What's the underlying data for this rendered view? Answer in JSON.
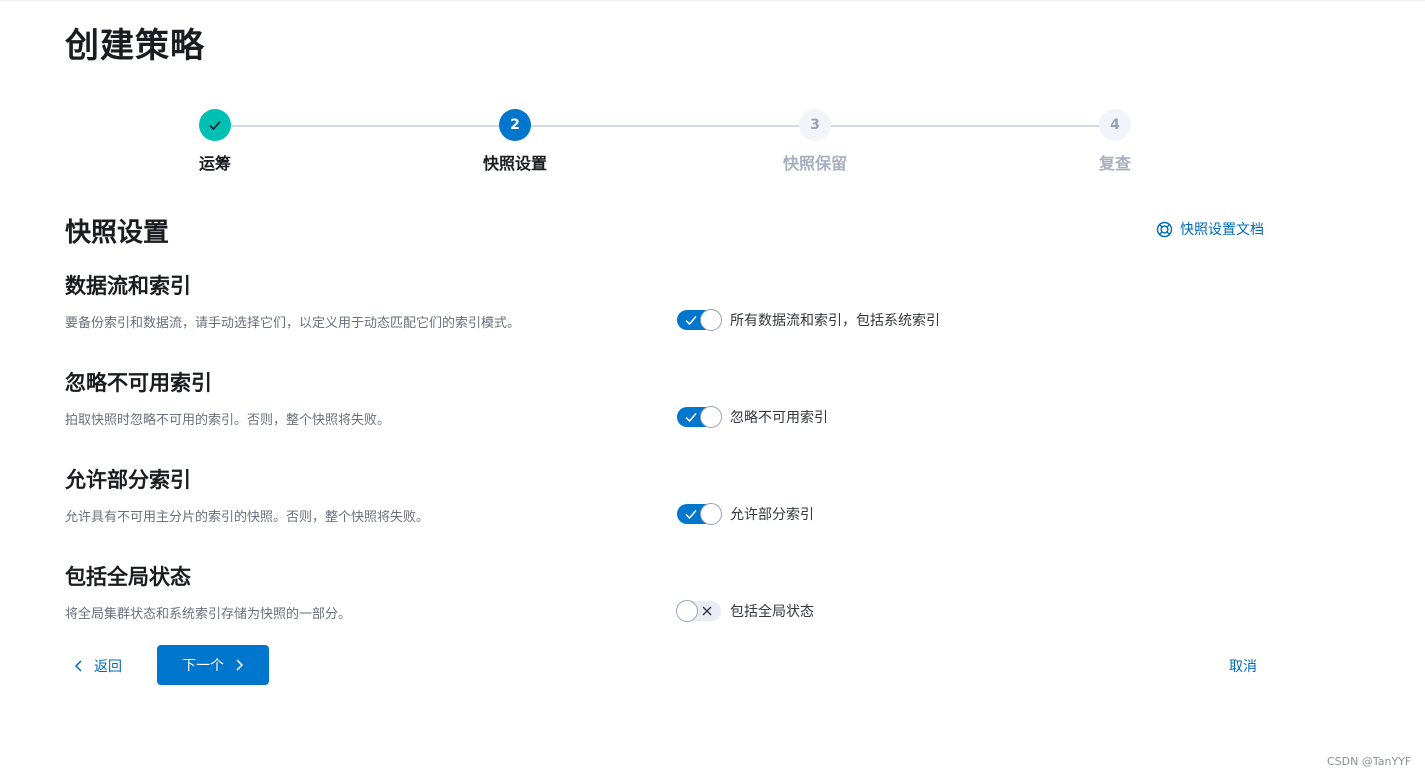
{
  "page": {
    "title": "创建策略"
  },
  "steps": [
    {
      "number": "1",
      "label": "运筹",
      "status": "complete"
    },
    {
      "number": "2",
      "label": "快照设置",
      "status": "current"
    },
    {
      "number": "3",
      "label": "快照保留",
      "status": "disabled"
    },
    {
      "number": "4",
      "label": "复查",
      "status": "disabled"
    }
  ],
  "section": {
    "title": "快照设置",
    "docs_link": "快照设置文档"
  },
  "settings": [
    {
      "title": "数据流和索引",
      "description": "要备份索引和数据流，请手动选择它们，以定义用于动态匹配它们的索引模式。",
      "toggle_label": "所有数据流和索引，包括系统索引",
      "enabled": true
    },
    {
      "title": "忽略不可用索引",
      "description": "拍取快照时忽略不可用的索引。否则，整个快照将失败。",
      "toggle_label": "忽略不可用索引",
      "enabled": true
    },
    {
      "title": "允许部分索引",
      "description": "允许具有不可用主分片的索引的快照。否则，整个快照将失败。",
      "toggle_label": "允许部分索引",
      "enabled": true
    },
    {
      "title": "包括全局状态",
      "description": "将全局集群状态和系统索引存储为快照的一部分。",
      "toggle_label": "包括全局状态",
      "enabled": false
    }
  ],
  "footer": {
    "back_label": "返回",
    "next_label": "下一个",
    "cancel_label": "取消"
  },
  "watermark": "CSDN @TanYYF",
  "colors": {
    "primary": "#0077cc",
    "success": "#00bfb3",
    "link": "#006bb8",
    "muted": "#a7afbe"
  }
}
